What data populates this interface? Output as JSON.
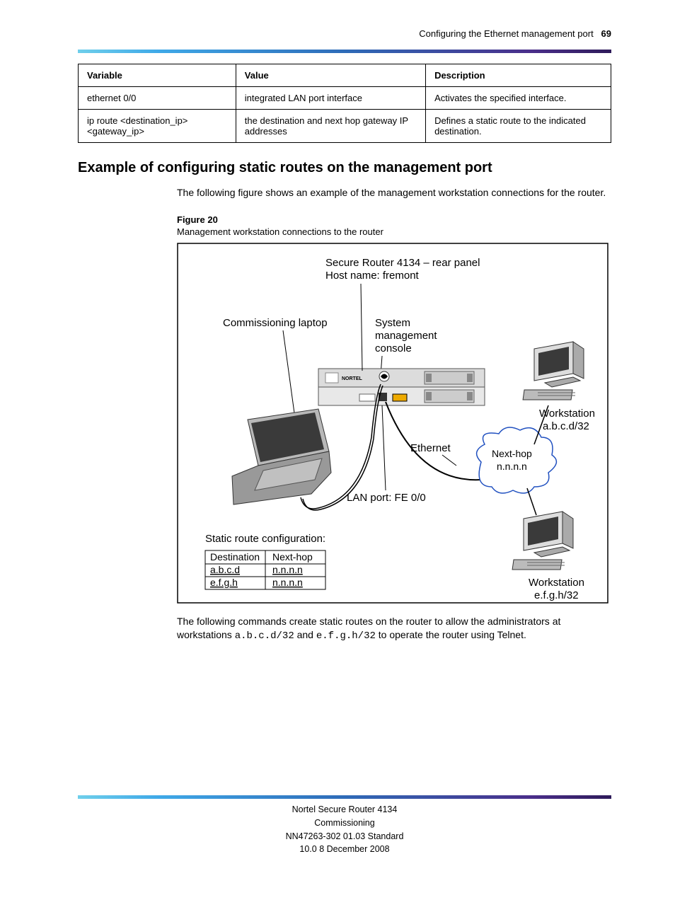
{
  "header": {
    "title_line1": "Configuring the Ethernet management port",
    "page_number": "69"
  },
  "table": {
    "headers": [
      "Variable",
      "Value",
      "Description"
    ],
    "rows": [
      [
        "ethernet 0/0",
        "integrated LAN port interface",
        "Activates the specified interface."
      ],
      [
        "ip route <destination_ip> <gateway_ip>",
        "the destination and next hop gateway IP addresses",
        "Defines a static route to the indicated destination."
      ]
    ]
  },
  "section": {
    "heading": "Example of configuring static routes on the management port",
    "body1": "The following figure shows an example of the management workstation connections for the router.",
    "figure_label": "Figure 20",
    "figure_title": "Management workstation connections to the router"
  },
  "diagram": {
    "router_label1": "Secure Router 4134 – rear panel",
    "router_label2": "Host name: fremont",
    "laptop_label": "Commissioning laptop",
    "console_label1": "System",
    "console_label2": "management",
    "console_label3": "console",
    "ethernet_label": "Ethernet",
    "lan_port_label": "LAN port: FE 0/0",
    "nexthop_label1": "Next-hop",
    "nexthop_label2": "n.n.n.n",
    "workstation1_label1": "Workstation",
    "workstation1_label2": "a.b.c.d/32",
    "workstation2_label1": "Workstation",
    "workstation2_label2": "e.f.g.h/32",
    "static_route_label": "Static route configuration:",
    "static_table_headers": [
      "Destination",
      "Next-hop"
    ],
    "static_table_rows": [
      [
        "a.b.c.d",
        "n.n.n.n"
      ],
      [
        "e.f.g.h",
        "n.n.n.n"
      ]
    ]
  },
  "post_figure_body": "The following commands create static routes on the router to allow the administrators at workstations ",
  "post_figure_code1": "a.b.c.d/32",
  "post_figure_mid": " and ",
  "post_figure_code2": "e.f.g.h/32",
  "post_figure_end": " to operate the router using Telnet.",
  "footer": {
    "line1": "Nortel Secure Router 4134",
    "line2": "Commissioning",
    "line3_left": "NN47263-302",
    "line3_mid": "   01.03 Standard",
    "line4": "10.0   8 December 2008"
  }
}
